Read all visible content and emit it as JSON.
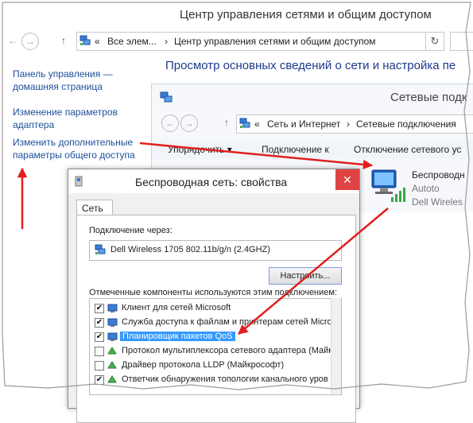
{
  "main_window": {
    "title": "Центр управления сетями и общим доступом",
    "address": {
      "overflow": "«",
      "crumb1": "Все элем...",
      "sep": "›",
      "crumb2": "Центр управления сетями и общим доступом"
    },
    "nav": {
      "back": "←",
      "forward": "→",
      "up": "↑",
      "refresh": "↻"
    },
    "left_links": [
      "Панель управления —",
      "домашняя страница",
      "Изменение параметров",
      "адаптера",
      "Изменить дополнительные",
      "параметры общего доступа"
    ],
    "heading": "Просмотр основных сведений о сети и настройка пе"
  },
  "connections_window": {
    "title": "Сетевые подк",
    "address": {
      "overflow": "«",
      "crumb1": "Сеть и Интернет",
      "sep": "›",
      "crumb2": "Сетевые подключения"
    },
    "toolbar": [
      "Упорядочить ▾",
      "Подключение к",
      "Отключение сетевого ус"
    ],
    "connection": {
      "name": "Беспроводн",
      "status": "Autoto",
      "device": "Dell Wireles"
    }
  },
  "dialog": {
    "title": "Беспроводная сеть: свойства",
    "close": "✕",
    "tab": "Сеть",
    "connect_via_label": "Подключение через:",
    "adapter": "Dell Wireless 1705 802.11b/g/n (2.4GHZ)",
    "configure_button": "Настроить...",
    "components_label": "Отмеченные компоненты используются этим подключением:",
    "components": [
      {
        "label": "Клиент для сетей Microsoft",
        "checked": "✔"
      },
      {
        "label": "Служба доступа к файлам и принтерам сетей Micro",
        "checked": "✔"
      },
      {
        "label": "Планировщик пакетов QoS",
        "checked": "✔"
      },
      {
        "label": "Протокол мультиплексора сетевого адаптера (Майк",
        "checked": ""
      },
      {
        "label": "Драйвер протокола LLDP (Майкрософт)",
        "checked": ""
      },
      {
        "label": "Ответчик обнаружения топологии канального уров",
        "checked": "✔"
      }
    ]
  },
  "colors": {
    "arrow": "#e0201f",
    "link": "#1c4e9c",
    "selection": "#3399ff",
    "close_button": "#e04343"
  }
}
